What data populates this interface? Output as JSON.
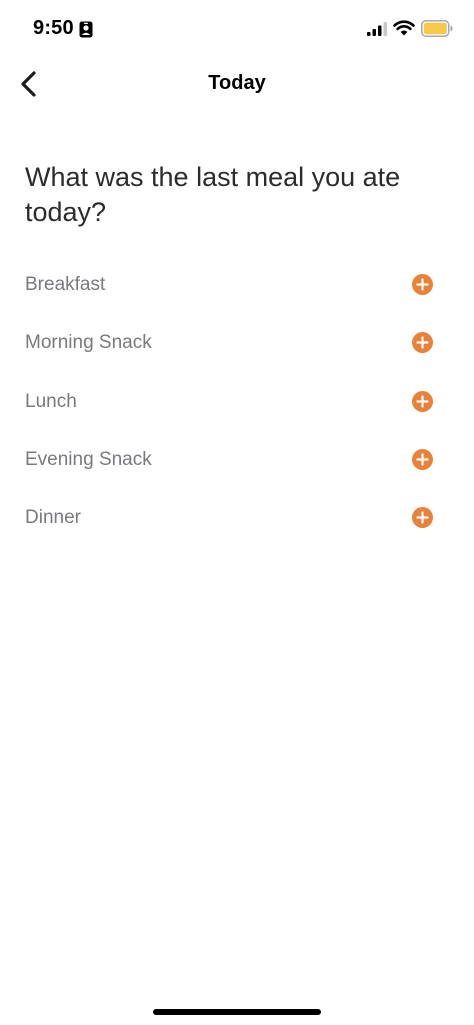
{
  "status_bar": {
    "time": "9:50",
    "icons": [
      "contact-card-icon",
      "cellular-signal-icon",
      "wifi-icon",
      "battery-icon"
    ],
    "battery_color": "#f7c948"
  },
  "nav": {
    "back_icon": "chevron-left-icon",
    "title": "Today"
  },
  "question": "What was the last meal you ate today?",
  "meals": [
    {
      "label": "Breakfast",
      "icon": "plus-circle-icon"
    },
    {
      "label": "Morning Snack",
      "icon": "plus-circle-icon"
    },
    {
      "label": "Lunch",
      "icon": "plus-circle-icon"
    },
    {
      "label": "Evening Snack",
      "icon": "plus-circle-icon"
    },
    {
      "label": "Dinner",
      "icon": "plus-circle-icon"
    }
  ],
  "colors": {
    "accent": "#e8823a",
    "label_text": "#7a7a7e"
  }
}
